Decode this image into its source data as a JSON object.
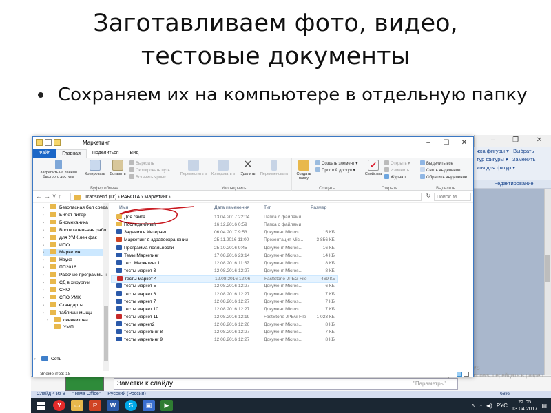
{
  "slide": {
    "title_line1": "Заготавливаем фото, видео,",
    "title_line2": "тестовые документы",
    "bullet": "Сохраняем их на компьютере в отдельную папку"
  },
  "explorer": {
    "window_title": "Маркетинг",
    "tabs": [
      "Файл",
      "Главная",
      "Поделиться",
      "Вид"
    ],
    "ribbon": {
      "clipboard": {
        "pin": "Закрепить на панели быстрого доступа",
        "copy": "Копировать",
        "paste": "Вставить",
        "cut": "Вырезать",
        "copy_path": "Скопировать путь",
        "paste_shortcut": "Вставить ярлык",
        "group": "Буфер обмена"
      },
      "organize": {
        "move_to": "Переместить в",
        "copy_to": "Копировать в",
        "delete": "Удалить",
        "rename": "Переименовать",
        "group": "Упорядочить"
      },
      "new": {
        "new_folder": "Создать папку",
        "new_item": "Создать элемент",
        "easy_access": "Простой доступ",
        "group": "Создать"
      },
      "open": {
        "properties": "Свойства",
        "open": "Открыть",
        "edit": "Изменить",
        "history": "Журнал",
        "group": "Открыть"
      },
      "select": {
        "select_all": "Выделить все",
        "select_none": "Снять выделение",
        "invert": "Обратить выделение",
        "group": "Выделить"
      }
    },
    "address": {
      "path": "Transcend (D:) › РАБОТА › Маркетинг ›",
      "search_placeholder": "Поиск: М..."
    },
    "nav_items": [
      "Безопасная бол среда",
      "Билет питер",
      "Биомеханика",
      "Воспитательная работ",
      "для УМК леч фак",
      "ИПО",
      "Маркетинг",
      "Наука",
      "ПП2016",
      "Рабочие программы н",
      "СД в хирургии",
      "СНО",
      "СПО УМК",
      "Стандарты",
      "таблицы мыщц",
      "свечникова",
      "УМП",
      "Сеть"
    ],
    "columns": {
      "name": "Имя",
      "date": "Дата изменения",
      "type": "Тип",
      "size": "Размер"
    },
    "files": [
      {
        "name": "Для сайта",
        "date": "13.04.2017 22:04",
        "type": "Папка с файлами",
        "size": "",
        "icon": "folder"
      },
      {
        "name": "Последнийный",
        "date": "16.12.2016 0:59",
        "type": "Папка с файлами",
        "size": "",
        "icon": "folder"
      },
      {
        "name": "Задания в Интернет",
        "date": "06.04.2017 9:53",
        "type": "Документ Micros...",
        "size": "15 КБ",
        "icon": "word"
      },
      {
        "name": "Маркетинг в здравоохранении",
        "date": "25.11.2016 11:00",
        "type": "Презентация Mic...",
        "size": "3 856 КБ",
        "icon": "ppt"
      },
      {
        "name": "Программа лояльности",
        "date": "25.10.2016 9:45",
        "type": "Документ Micros...",
        "size": "16 КБ",
        "icon": "word"
      },
      {
        "name": "Темы Маркетинг",
        "date": "17.08.2016 23:14",
        "type": "Документ Micros...",
        "size": "14 КБ",
        "icon": "word"
      },
      {
        "name": "тест Маркетинг 1",
        "date": "12.08.2016 11:57",
        "type": "Документ Micros...",
        "size": "8 КБ",
        "icon": "word"
      },
      {
        "name": "тесты маркет 3",
        "date": "12.08.2016 12:27",
        "type": "Документ Micros...",
        "size": "8 КБ",
        "icon": "word"
      },
      {
        "name": "тесты маркет 4",
        "date": "12.08.2016 12:06",
        "type": "FastStone JPEG File",
        "size": "469 КБ",
        "icon": "jpg"
      },
      {
        "name": "тесты маркет 5",
        "date": "12.08.2016 12:27",
        "type": "Документ Micros...",
        "size": "6 КБ",
        "icon": "word"
      },
      {
        "name": "тесты маркет 6",
        "date": "12.08.2016 12:27",
        "type": "Документ Micros...",
        "size": "7 КБ",
        "icon": "word"
      },
      {
        "name": "тесты маркет 7",
        "date": "12.08.2016 12:27",
        "type": "Документ Micros...",
        "size": "7 КБ",
        "icon": "word"
      },
      {
        "name": "тесты маркет 10",
        "date": "12.08.2016 12:27",
        "type": "Документ Micros...",
        "size": "7 КБ",
        "icon": "word"
      },
      {
        "name": "тесты маркет 11",
        "date": "12.08.2016 12:19",
        "type": "FastStone JPEG File",
        "size": "1 023 КБ",
        "icon": "jpg"
      },
      {
        "name": "тесты маркет2",
        "date": "12.08.2016 12:26",
        "type": "Документ Micros...",
        "size": "8 КБ",
        "icon": "word"
      },
      {
        "name": "тесты маркетинг 8",
        "date": "12.08.2016 12:27",
        "type": "Документ Micros...",
        "size": "7 КБ",
        "icon": "word"
      },
      {
        "name": "тесты маркетинг 9",
        "date": "12.08.2016 12:27",
        "type": "Документ Micros...",
        "size": "8 КБ",
        "icon": "word"
      }
    ],
    "status": "Элементов: 18"
  },
  "ppt": {
    "ribbon_items": [
      "Выбрать",
      "Заменить",
      "Редактирование"
    ],
    "ribbon_left": [
      "жка фигуры",
      "тур фигуры",
      "кты для фигур"
    ],
    "notes_placeholder": "Заметки к слайду",
    "status_slide": "Слайд 4 из 8",
    "status_theme": "\"Тема Office\"",
    "status_lang": "Русский (Россия)",
    "zoom": "68%",
    "watermark_title": "Активация Windows",
    "watermark_text": "Чтобы активировать Windows, перейдите в раздел \"Параметры\"."
  },
  "taskbar": {
    "lang": "РУС",
    "time": "22:05",
    "date": "13.04.2017"
  },
  "colors": {
    "file_tab": "#1a66c7",
    "selection": "#cce8ff",
    "folder": "#e8b84c",
    "taskbar": "#1b2733",
    "annotation": "#c8161d"
  }
}
